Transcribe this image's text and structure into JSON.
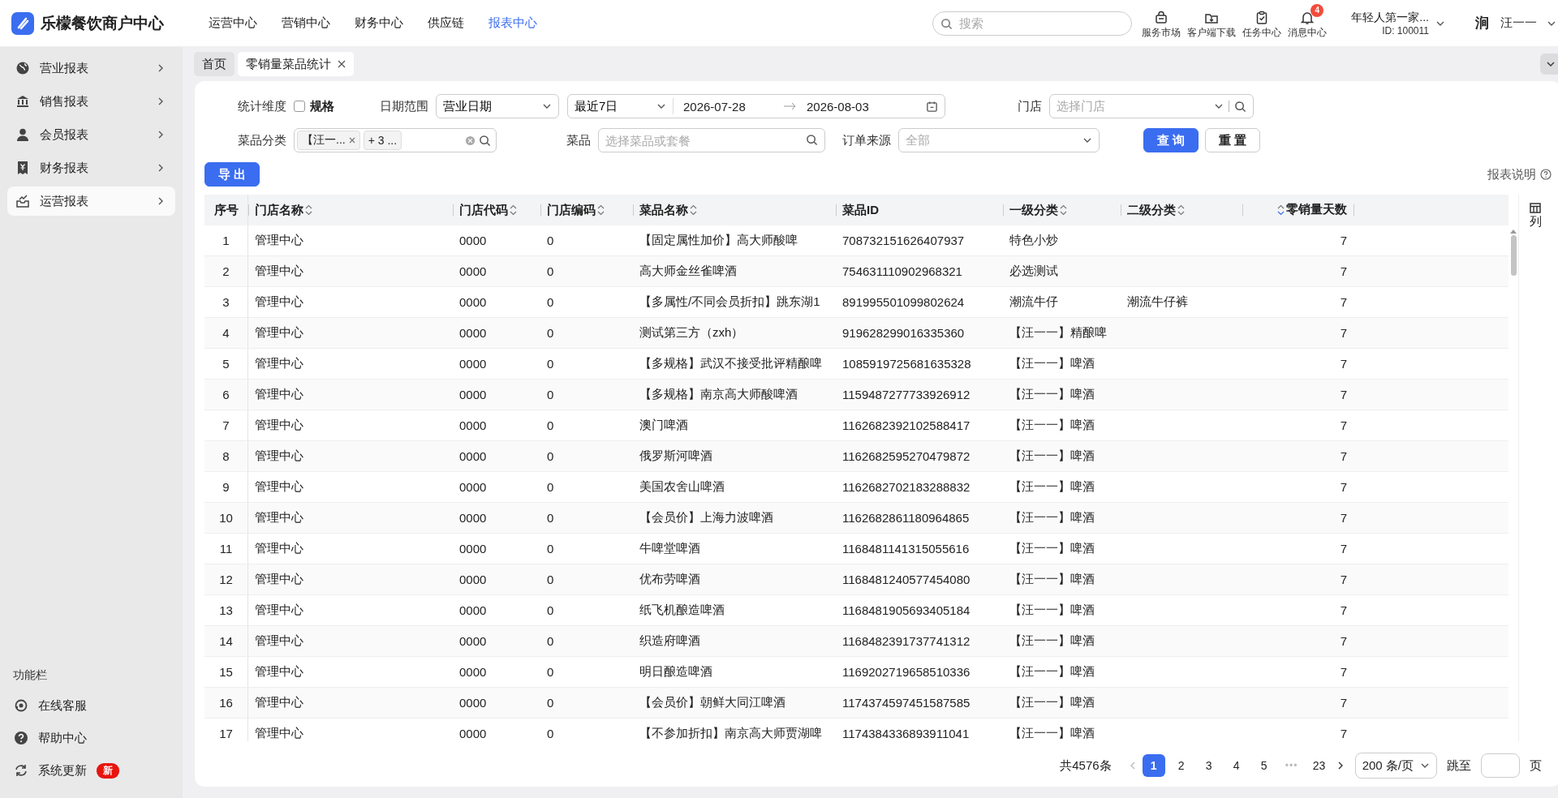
{
  "app": {
    "logo_text": "乐檬餐饮商户中心"
  },
  "top_nav": [
    {
      "label": "运营中心",
      "selected": false
    },
    {
      "label": "营销中心",
      "selected": false
    },
    {
      "label": "财务中心",
      "selected": false
    },
    {
      "label": "供应链",
      "selected": false
    },
    {
      "label": "报表中心",
      "selected": true
    }
  ],
  "search": {
    "placeholder": "搜索"
  },
  "tools": [
    {
      "kind": "shop",
      "label": "服务市场"
    },
    {
      "kind": "download",
      "label": "客户端下载"
    },
    {
      "kind": "task",
      "label": "任务中心"
    },
    {
      "kind": "message",
      "label": "消息中心",
      "badge": "4"
    }
  ],
  "account": {
    "name": "年轻人第一家...",
    "id": "ID: 100011"
  },
  "user": {
    "avatar_text": "涧",
    "name": "汪一一"
  },
  "sidebar": {
    "items": [
      {
        "kind": "globe",
        "label": "营业报表",
        "selected": false
      },
      {
        "kind": "bank",
        "label": "销售报表",
        "selected": false
      },
      {
        "kind": "person",
        "label": "会员报表",
        "selected": false
      },
      {
        "kind": "receipt",
        "label": "财务报表",
        "selected": false
      },
      {
        "kind": "chart",
        "label": "运营报表",
        "selected": true
      }
    ],
    "section_title": "功能栏",
    "tools": [
      {
        "kind": "headset",
        "label": "在线客服"
      },
      {
        "kind": "help",
        "label": "帮助中心"
      },
      {
        "kind": "refresh",
        "label": "系统更新",
        "badge": "新"
      }
    ]
  },
  "tabs": [
    {
      "label": "首页",
      "selected": false,
      "closable": false
    },
    {
      "label": "零销量菜品统计",
      "selected": true,
      "closable": true
    }
  ],
  "filters": [
    [
      {
        "kind": "checkbox",
        "label": "统计维度",
        "option": "规格",
        "checked": false
      },
      {
        "kind": "daterange",
        "label": "日期范围",
        "type": "营业日期",
        "preset": "最近7日",
        "start": "2026-07-28",
        "end": "2026-08-03"
      },
      {
        "kind": "store",
        "label": "门店",
        "placeholder": "选择门店"
      }
    ],
    [
      {
        "kind": "tags",
        "label": "菜品分类",
        "tags": [
          {
            "label": "【汪一...",
            "closable": true
          },
          {
            "label": "+ 3 ...",
            "closable": false
          }
        ]
      },
      {
        "kind": "search",
        "label": "菜品",
        "placeholder": "选择菜品或套餐"
      },
      {
        "kind": "select",
        "label": "订单来源",
        "placeholder": "全部"
      },
      {
        "kind": "buttons",
        "buttons": [
          {
            "label": "查 询",
            "primary": true
          },
          {
            "label": "重 置",
            "primary": false
          }
        ]
      }
    ]
  ],
  "export_button": "导 出",
  "help_link": "报表说明",
  "table": {
    "columns": [
      {
        "label": "序号",
        "sortable": false,
        "kind": "index"
      },
      {
        "label": "门店名称",
        "sortable": true,
        "sorted": false,
        "kind": "text"
      },
      {
        "label": "门店代码",
        "sortable": true,
        "sorted": false,
        "kind": "text"
      },
      {
        "label": "门店编码",
        "sortable": true,
        "sorted": false,
        "kind": "text"
      },
      {
        "label": "菜品名称",
        "sortable": true,
        "sorted": false,
        "kind": "text"
      },
      {
        "label": "菜品ID",
        "sortable": false,
        "kind": "text"
      },
      {
        "label": "一级分类",
        "sortable": true,
        "sorted": false,
        "kind": "text"
      },
      {
        "label": "二级分类",
        "sortable": true,
        "sorted": false,
        "kind": "text"
      },
      {
        "label": "零销量天数",
        "sortable": true,
        "sorted": true,
        "kind": "number"
      }
    ],
    "rows": [
      [
        "1",
        "管理中心",
        "0000",
        "0",
        "【固定属性加价】高大师酸啤",
        "708732151626407937",
        "特色小炒",
        null,
        "7"
      ],
      [
        "2",
        "管理中心",
        "0000",
        "0",
        "高大师金丝雀啤酒",
        "754631110902968321",
        "必选测试",
        null,
        "7"
      ],
      [
        "3",
        "管理中心",
        "0000",
        "0",
        "【多属性/不同会员折扣】跳东湖1",
        "891995501099802624",
        "潮流牛仔",
        "潮流牛仔裤",
        "7"
      ],
      [
        "4",
        "管理中心",
        "0000",
        "0",
        "测试第三方（zxh）",
        "919628299016335360",
        "【汪一一】精酿啤",
        null,
        "7"
      ],
      [
        "5",
        "管理中心",
        "0000",
        "0",
        "【多规格】武汉不接受批评精酿啤",
        "1085919725681635328",
        "【汪一一】啤酒",
        null,
        "7"
      ],
      [
        "6",
        "管理中心",
        "0000",
        "0",
        "【多规格】南京高大师酸啤酒",
        "1159487277733926912",
        "【汪一一】啤酒",
        null,
        "7"
      ],
      [
        "7",
        "管理中心",
        "0000",
        "0",
        "澳门啤酒",
        "1162682392102588417",
        "【汪一一】啤酒",
        null,
        "7"
      ],
      [
        "8",
        "管理中心",
        "0000",
        "0",
        "俄罗斯河啤酒",
        "1162682595270479872",
        "【汪一一】啤酒",
        null,
        "7"
      ],
      [
        "9",
        "管理中心",
        "0000",
        "0",
        "美国农舍山啤酒",
        "1162682702183288832",
        "【汪一一】啤酒",
        null,
        "7"
      ],
      [
        "10",
        "管理中心",
        "0000",
        "0",
        "【会员价】上海力波啤酒",
        "1162682861180964865",
        "【汪一一】啤酒",
        null,
        "7"
      ],
      [
        "11",
        "管理中心",
        "0000",
        "0",
        "牛啤堂啤酒",
        "1168481141315055616",
        "【汪一一】啤酒",
        null,
        "7"
      ],
      [
        "12",
        "管理中心",
        "0000",
        "0",
        "优布劳啤酒",
        "1168481240577454080",
        "【汪一一】啤酒",
        null,
        "7"
      ],
      [
        "13",
        "管理中心",
        "0000",
        "0",
        "纸飞机酿造啤酒",
        "1168481905693405184",
        "【汪一一】啤酒",
        null,
        "7"
      ],
      [
        "14",
        "管理中心",
        "0000",
        "0",
        "织造府啤酒",
        "1168482391737741312",
        "【汪一一】啤酒",
        null,
        "7"
      ],
      [
        "15",
        "管理中心",
        "0000",
        "0",
        "明日酿造啤酒",
        "1169202719658510336",
        "【汪一一】啤酒",
        null,
        "7"
      ],
      [
        "16",
        "管理中心",
        "0000",
        "0",
        "【会员价】朝鲜大同江啤酒",
        "1174374597451587585",
        "【汪一一】啤酒",
        null,
        "7"
      ],
      [
        "17",
        "管理中心",
        "0000",
        "0",
        "【不参加折扣】南京高大师贾湖啤",
        "1174384336893911041",
        "【汪一一】啤酒",
        null,
        "7"
      ]
    ]
  },
  "column_settings": "列",
  "pagination": {
    "total": "共4576条",
    "pages": [
      {
        "kind": "page",
        "label": "1",
        "selected": true
      },
      {
        "kind": "page",
        "label": "2",
        "selected": false
      },
      {
        "kind": "page",
        "label": "3",
        "selected": false
      },
      {
        "kind": "page",
        "label": "4",
        "selected": false
      },
      {
        "kind": "page",
        "label": "5",
        "selected": false
      },
      {
        "kind": "ellipsis",
        "label": "•••"
      },
      {
        "kind": "page",
        "label": "23",
        "selected": false
      }
    ],
    "page_size": "200 条/页",
    "jump_label": "跳至",
    "jump_suffix": "页"
  }
}
